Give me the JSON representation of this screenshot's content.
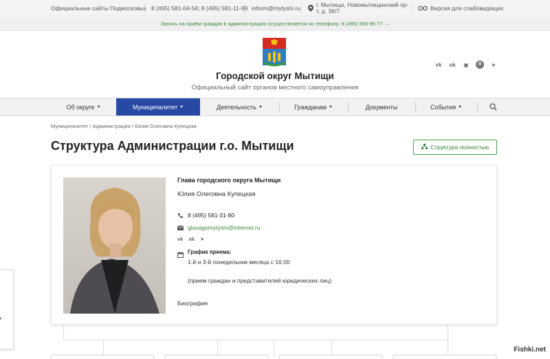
{
  "topbar": {
    "official_sites": "Официальные сайты Подмосковья",
    "phones": "8 (495) 581-04-56; 8 (495) 581-11-99",
    "email": "inform@mytyshi.ru",
    "address_line1": "г. Мытищи, Новомытищинский пр-",
    "address_line2": "т, д. 36/7",
    "accessibility": "Версия для слабовидящих"
  },
  "notice": "Запись на приём граждан в администрацию осуществляется по телефону: 8 (495) 586-95-77 →",
  "header": {
    "title": "Городской округ Мытищи",
    "subtitle": "Официальный сайт органов местного самоуправления"
  },
  "social": [
    "vk",
    "ok",
    "dzen",
    "rutube",
    "telegram"
  ],
  "nav": {
    "items": [
      {
        "label": "Об округе",
        "caret": "▼"
      },
      {
        "label": "Муниципалитет",
        "caret": "▼"
      },
      {
        "label": "Деятельность",
        "caret": "▼"
      },
      {
        "label": "Гражданам",
        "caret": "▼"
      },
      {
        "label": "Документы",
        "caret": ""
      },
      {
        "label": "События",
        "caret": "▼"
      }
    ],
    "active_index": 1
  },
  "breadcrumb": "Муниципалитет / Администрация / Юлия Олеговна Купецкая",
  "page_title": "Структура Администрации г.о. Мытищи",
  "structure_button": "Структура полностью",
  "person": {
    "position": "Глава городского округа Мытищи",
    "name": "Юлия Олеговна Купецкая",
    "phone": "8 (495) 581-31-80",
    "email": "glavagomytyshi@internet.ru",
    "schedule_title": "График приема:",
    "schedule_line1": "1-й и 3-й понедельник месяца с 16.00",
    "schedule_line2": "(прием граждан и представителей юридических лиц)",
    "bio_link": "Биография"
  },
  "side_widget_text": "х",
  "watermark": "Fishki.net",
  "colors": {
    "nav_active": "#2748a4",
    "accent_green": "#3a8a3f"
  }
}
